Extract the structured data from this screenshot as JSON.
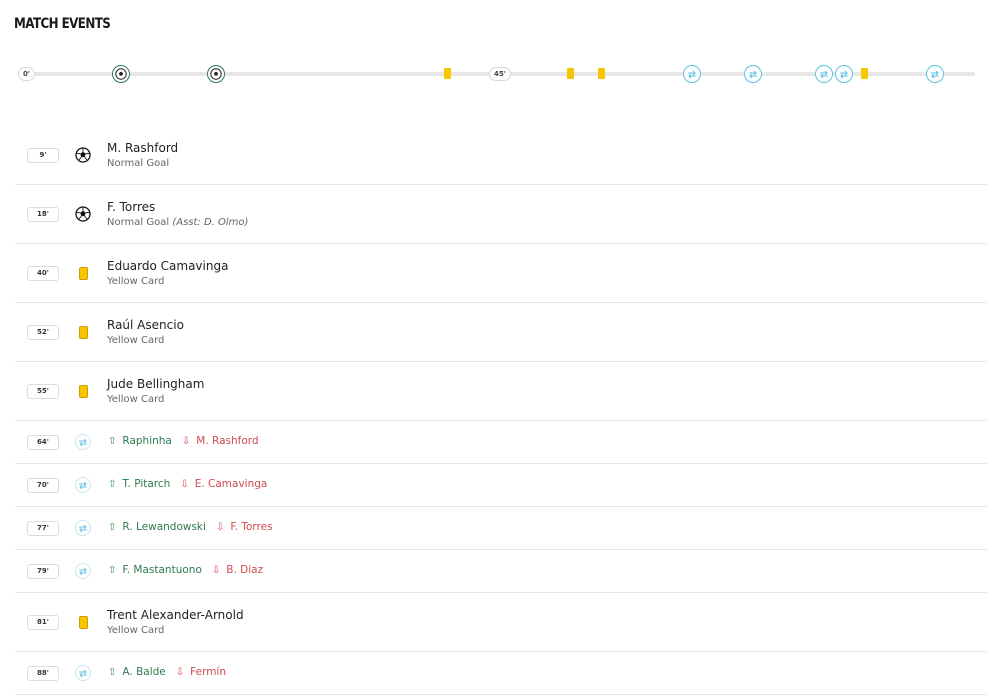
{
  "title": "MATCH EVENTS",
  "timeline": {
    "start_marker": "0'",
    "half_marker": "45'",
    "colors": {
      "goal": "#2f7d5a",
      "card": "#f7c600",
      "sub": "#5bc3e5"
    },
    "events": [
      {
        "minute": 9,
        "type": "goal"
      },
      {
        "minute": 18,
        "type": "goal"
      },
      {
        "minute": 40,
        "type": "card"
      },
      {
        "minute": 52,
        "type": "card"
      },
      {
        "minute": 55,
        "type": "card"
      },
      {
        "minute": 64,
        "type": "sub"
      },
      {
        "minute": 70,
        "type": "sub"
      },
      {
        "minute": 77,
        "type": "sub"
      },
      {
        "minute": 79,
        "type": "sub"
      },
      {
        "minute": 81,
        "type": "card"
      },
      {
        "minute": 88,
        "type": "sub"
      }
    ]
  },
  "events": [
    {
      "minute": "9'",
      "type": "goal",
      "icon": "soccer-ball-icon",
      "player": "M. Rashford",
      "desc": "Normal Goal",
      "assist": ""
    },
    {
      "minute": "18'",
      "type": "goal",
      "icon": "soccer-ball-icon",
      "player": "F. Torres",
      "desc": "Normal Goal",
      "assist": "(Asst: D. Olmo)"
    },
    {
      "minute": "40'",
      "type": "card",
      "icon": "yellow-card-icon",
      "player": "Eduardo Camavinga",
      "desc": "Yellow Card"
    },
    {
      "minute": "52'",
      "type": "card",
      "icon": "yellow-card-icon",
      "player": "Raúl Asencio",
      "desc": "Yellow Card"
    },
    {
      "minute": "55'",
      "type": "card",
      "icon": "yellow-card-icon",
      "player": "Jude Bellingham",
      "desc": "Yellow Card"
    },
    {
      "minute": "64'",
      "type": "sub",
      "icon": "substitution-icon",
      "player_in": "Raphinha",
      "player_out": "M. Rashford"
    },
    {
      "minute": "70'",
      "type": "sub",
      "icon": "substitution-icon",
      "player_in": "T. Pitarch",
      "player_out": "E. Camavinga"
    },
    {
      "minute": "77'",
      "type": "sub",
      "icon": "substitution-icon",
      "player_in": "R. Lewandowski",
      "player_out": "F. Torres"
    },
    {
      "minute": "79'",
      "type": "sub",
      "icon": "substitution-icon",
      "player_in": "F. Mastantuono",
      "player_out": "B. Diaz"
    },
    {
      "minute": "81'",
      "type": "card",
      "icon": "yellow-card-icon",
      "player": "Trent Alexander-Arnold",
      "desc": "Yellow Card"
    },
    {
      "minute": "88'",
      "type": "sub",
      "icon": "substitution-icon",
      "player_in": "A. Balde",
      "player_out": "Fermín"
    }
  ]
}
